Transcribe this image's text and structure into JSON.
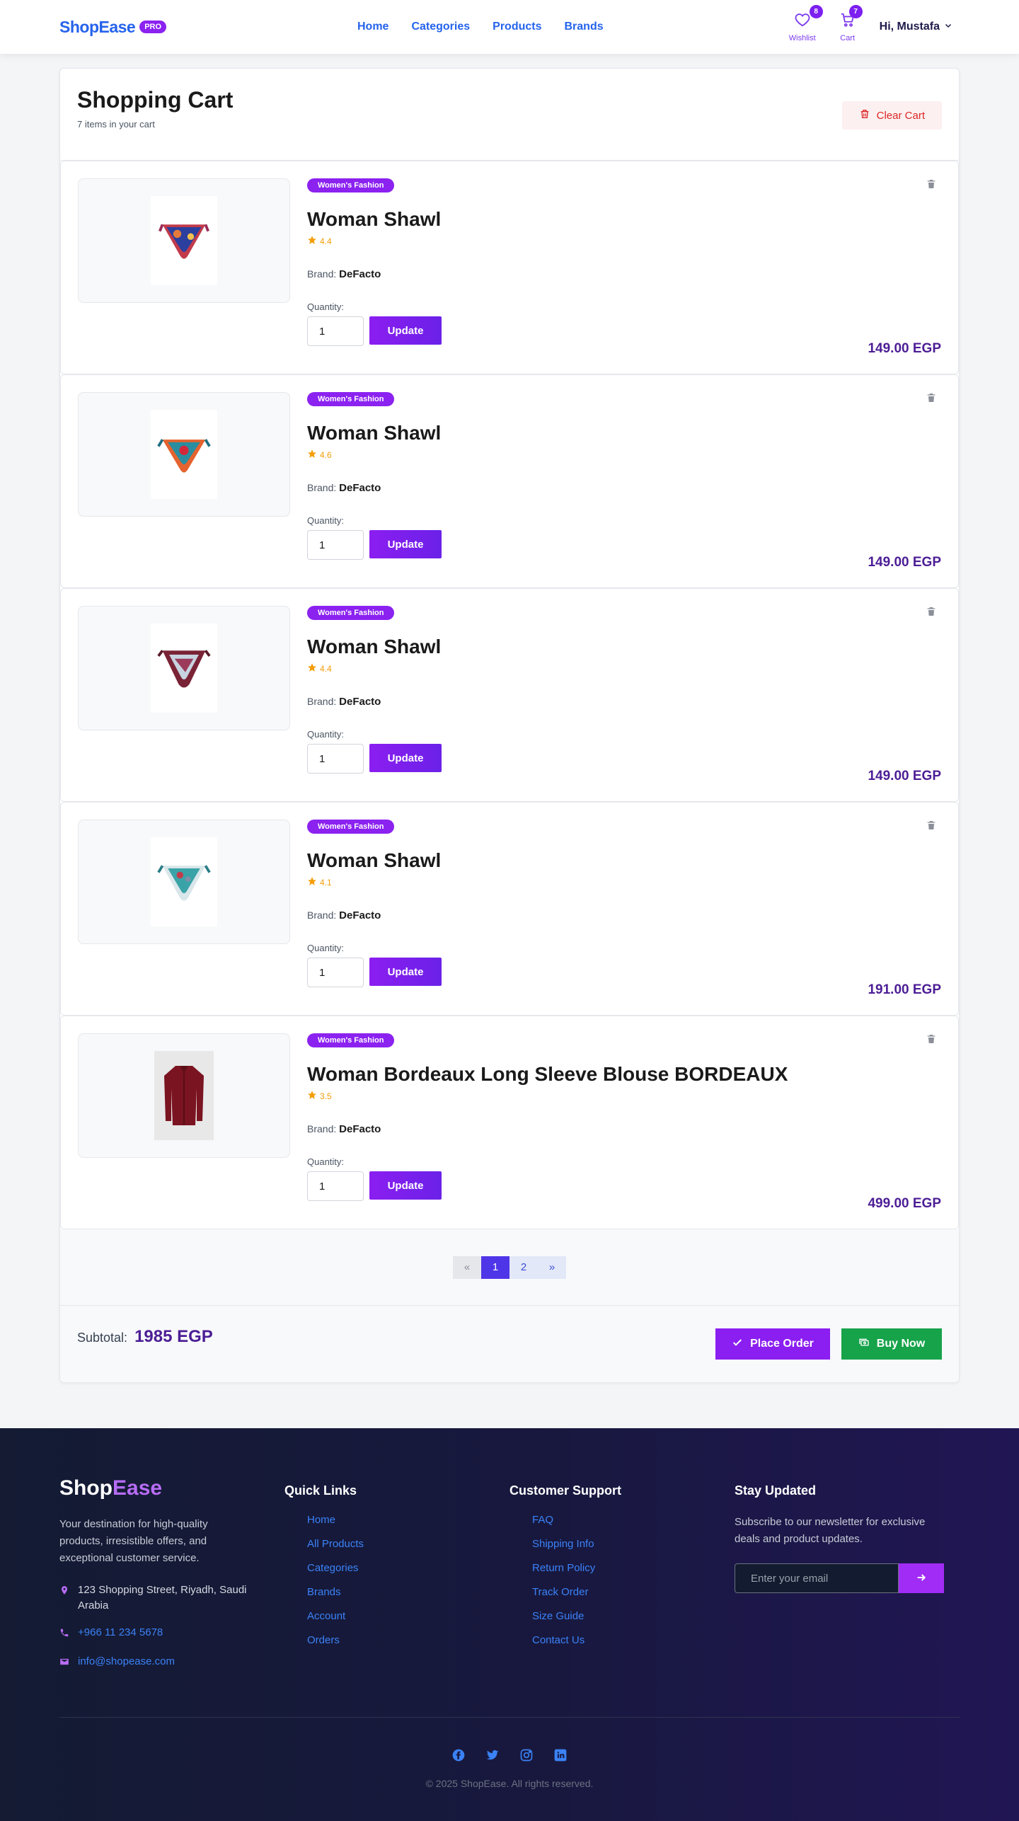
{
  "nav": {
    "brand": "ShopEase",
    "pro": "PRO",
    "links": [
      "Home",
      "Categories",
      "Products",
      "Brands"
    ],
    "wishlist_label": "Wishlist",
    "wishlist_count": "8",
    "cart_label": "Cart",
    "cart_count": "7",
    "user": "Hi, Mustafa"
  },
  "cart": {
    "title": "Shopping Cart",
    "subtitle": "7 items in your cart",
    "clear_label": "Clear Cart",
    "quantity_label": "Quantity:",
    "brand_prefix": "Brand:",
    "update_label": "Update",
    "items": [
      {
        "category": "Women's Fashion",
        "name": "Woman Shawl",
        "rating": "4.4",
        "brand": "DeFacto",
        "quantity": "1",
        "price": "149.00 EGP",
        "image": "shawl-red-blue"
      },
      {
        "category": "Women's Fashion",
        "name": "Woman Shawl",
        "rating": "4.6",
        "brand": "DeFacto",
        "quantity": "1",
        "price": "149.00 EGP",
        "image": "shawl-orange-teal"
      },
      {
        "category": "Women's Fashion",
        "name": "Woman Shawl",
        "rating": "4.4",
        "brand": "DeFacto",
        "quantity": "1",
        "price": "149.00 EGP",
        "image": "shawl-burgundy"
      },
      {
        "category": "Women's Fashion",
        "name": "Woman Shawl",
        "rating": "4.1",
        "brand": "DeFacto",
        "quantity": "1",
        "price": "191.00 EGP",
        "image": "shawl-teal-light"
      },
      {
        "category": "Women's Fashion",
        "name": "Woman Bordeaux Long Sleeve Blouse BORDEAUX",
        "rating": "3.5",
        "brand": "DeFacto",
        "quantity": "1",
        "price": "499.00 EGP",
        "image": "blouse-bordeaux"
      }
    ],
    "pagination": {
      "prev": "«",
      "pages": [
        "1",
        "2"
      ],
      "next": "»",
      "current": "1"
    },
    "subtotal_label": "Subtotal:",
    "subtotal_value": "1985 EGP",
    "place_order": "Place Order",
    "buy_now": "Buy Now"
  },
  "footer": {
    "brand_a": "Shop",
    "brand_b": "Ease",
    "description": "Your destination for high-quality products, irresistible offers, and exceptional customer service.",
    "address": "123 Shopping Street, Riyadh, Saudi Arabia",
    "phone": "+966 11 234 5678",
    "email": "info@shopease.com",
    "quick_links_title": "Quick Links",
    "quick_links": [
      "Home",
      "All Products",
      "Categories",
      "Brands",
      "Account",
      "Orders"
    ],
    "support_title": "Customer Support",
    "support_links": [
      "FAQ",
      "Shipping Info",
      "Return Policy",
      "Track Order",
      "Size Guide",
      "Contact Us"
    ],
    "newsletter_title": "Stay Updated",
    "newsletter_desc": "Subscribe to our newsletter for exclusive deals and product updates.",
    "newsletter_placeholder": "Enter your email",
    "socials": [
      "facebook-icon",
      "twitter-icon",
      "instagram-icon",
      "linkedin-icon"
    ],
    "copyright": "© 2025 ShopEase. All rights reserved."
  },
  "colors": {
    "brand": "#2563eb",
    "accent": "#8b22f0",
    "price": "#4c1d95",
    "danger": "#dc2626",
    "success": "#16a34a"
  }
}
